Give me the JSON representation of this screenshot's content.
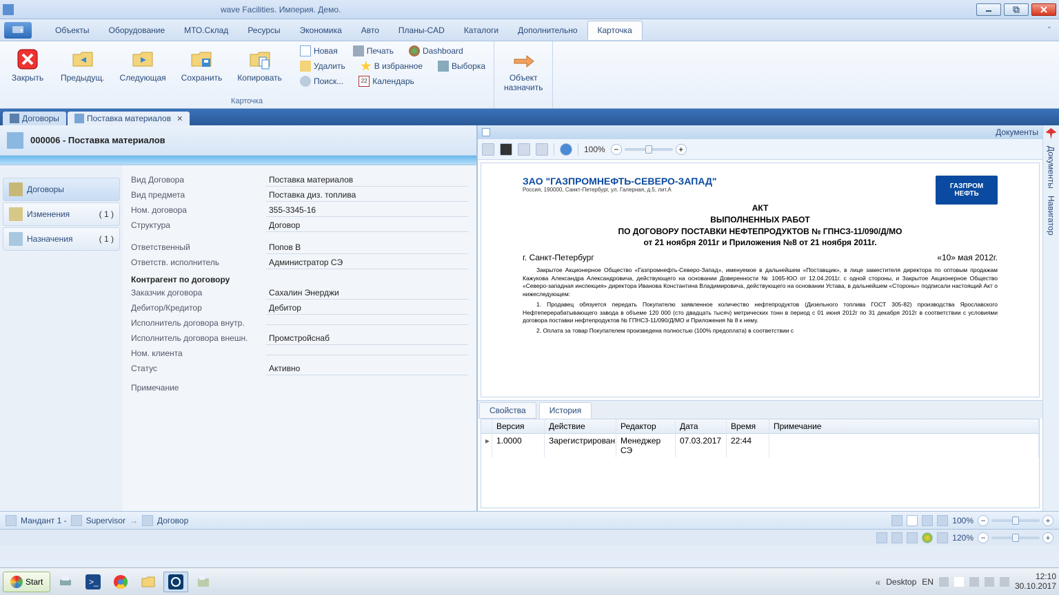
{
  "window": {
    "title": "wave Facilities. Империя. Демо."
  },
  "menu": {
    "items": [
      "Объекты",
      "Оборудование",
      "МТО.Склад",
      "Ресурсы",
      "Экономика",
      "Авто",
      "Планы-CAD",
      "Каталоги",
      "Дополнительно",
      "Карточка"
    ],
    "active": "Карточка"
  },
  "ribbon": {
    "group_label": "Карточка",
    "big": [
      "Закрыть",
      "Предыдущ.",
      "Следующая",
      "Сохранить",
      "Копировать"
    ],
    "small": [
      [
        "Новая",
        "Печать",
        "Dashboard"
      ],
      [
        "Удалить",
        "В избранное",
        "Выборка"
      ],
      [
        "Поиск...",
        "Календарь",
        ""
      ]
    ],
    "object_assign": "Объект\nназначить"
  },
  "doctabs": [
    {
      "label": "Договоры",
      "active": false
    },
    {
      "label": "Поставка материалов",
      "active": true
    }
  ],
  "card": {
    "title": "000006 - Поставка материалов"
  },
  "form_nav": [
    {
      "label": "Договоры",
      "count": "",
      "sel": true
    },
    {
      "label": "Изменения",
      "count": "( 1 )",
      "sel": false
    },
    {
      "label": "Назначения",
      "count": "( 1 )",
      "sel": false
    }
  ],
  "fields": {
    "vid_dogovora": {
      "lab": "Вид Договора",
      "val": "Поставка материалов"
    },
    "vid_predmeta": {
      "lab": "Вид предмета",
      "val": "Поставка диз. топлива"
    },
    "nom_dogovora": {
      "lab": "Ном. договора",
      "val": "355-3345-16"
    },
    "struktura": {
      "lab": "Структура",
      "val": "Договор"
    },
    "otvetstvenny": {
      "lab": "Ответственный",
      "val": "Попов В"
    },
    "otv_ispoln": {
      "lab": "Ответств. исполнитель",
      "val": "Администратор СЭ"
    },
    "sect_kontragent": "Контрагент по договору",
    "zakazchik": {
      "lab": "Заказчик договора",
      "val": "Сахалин Энерджи"
    },
    "debkred": {
      "lab": "Дебитор/Кредитор",
      "val": "Дебитор"
    },
    "isp_vnutr": {
      "lab": "Исполнитель договора внутр.",
      "val": ""
    },
    "isp_vnesh": {
      "lab": "Исполнитель договора внешн.",
      "val": "Промстройснаб"
    },
    "nom_klienta": {
      "lab": "Ном. клиента",
      "val": ""
    },
    "status": {
      "lab": "Статус",
      "val": "Активно"
    },
    "primech": {
      "lab": "Примечание",
      "val": ""
    }
  },
  "preview": {
    "panel_title": "Документы",
    "zoom": "100%",
    "company": "ЗАО \"ГАЗПРОМНЕФТЬ-СЕВЕРО-ЗАПАД\"",
    "logo": "ГАЗПРОМ\nНЕФТЬ",
    "address": "Россия, 190000, Санкт-Петербург, ул. Галерная, д.5, лит.А",
    "act_line1": "АКТ",
    "act_line2": "ВЫПОЛНЕННЫХ РАБОТ",
    "act_line3": "ПО ДОГОВОРУ ПОСТАВКИ НЕФТЕПРОДУКТОВ № ГПНСЗ-11/090/Д/МО",
    "act_line4": "от 21 ноября 2011г и Приложения №8 от 21 ноября 2011г.",
    "city": "г. Санкт-Петербург",
    "date": "«10»   мая   2012г.",
    "para1": "Закрытое Акционерное Общество «Газпромнефть-Северо-Запад», именуемое в дальнейшем «Поставщик», в лице заместителя директора по оптовым продажам Кажукова Александра Александровича, действующего на основании Доверенности № 1065-ЮО от 12.04.2011г. с одной стороны, и Закрытое Акционерное Общество «Северо-западная инспекция» директора Иванова Константина Владимировича, действующего на основании Устава, в дальнейшем «Стороны» подписали настоящий Акт о нижеследующем:",
    "para2": "1. Продавец обязуется передать Покупателю заявленное количество нефтепродуктов (Дизельного топлива ГОСТ 305-82) производства Ярославского Нефтеперерабатывающего завода в объеме 120 000 (сто двадцать тысяч) метрических тонн в период с 01 июня 2012г по 31 декабря 2012г в соответствии с условиями договора поставки нефтепродуктов № ГПНСЗ-11/090/Д/МО и Приложения № 8 к нему.",
    "para3": "2. Оплата за товар Покупателем произведена полностью (100% предоплата) в соответствии с"
  },
  "sub_tabs": [
    "Свойства",
    "История"
  ],
  "sub_tab_active": "История",
  "history": {
    "cols": [
      "",
      "Версия",
      "Действие",
      "Редактор",
      "Дата",
      "Время",
      "Примечание"
    ],
    "rows": [
      [
        "▸",
        "1.0000",
        "Зарегистрирован",
        "Менеджер СЭ",
        "07.03.2017",
        "22:44",
        ""
      ]
    ]
  },
  "side_rail": [
    "Документы",
    "Навигатор"
  ],
  "statusbar1": {
    "mandant": "Мандант 1 -",
    "user": "Supervisor",
    "crumb": "Договор",
    "zoom": "100%"
  },
  "statusbar2": {
    "zoom": "120%"
  },
  "taskbar": {
    "start": "Start",
    "desktop": "Desktop",
    "lang": "EN",
    "time": "12:10",
    "date": "30.10.2017"
  }
}
